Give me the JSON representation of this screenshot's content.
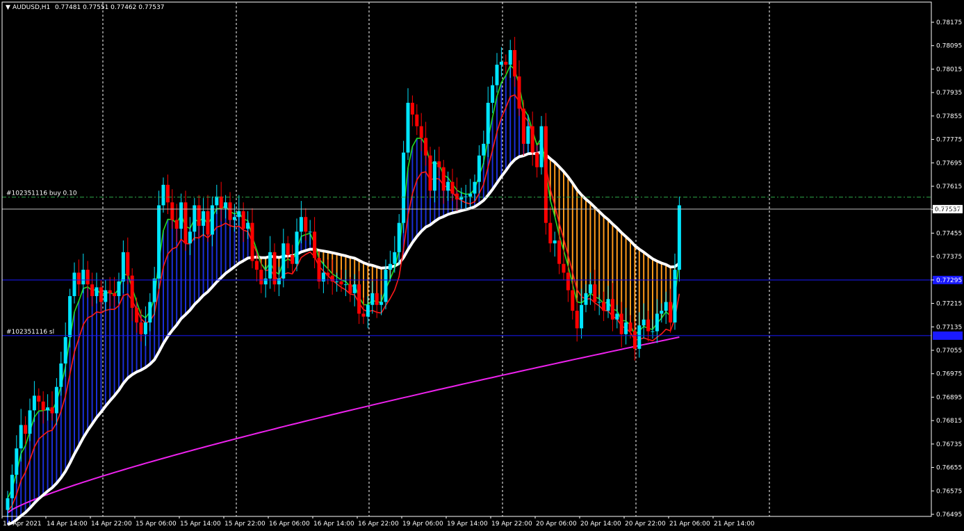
{
  "header": {
    "symbol": "AUDUSD,H1",
    "ohlc": "0.77481 0.77551 0.77462 0.77537"
  },
  "orders": {
    "buy_label": "#102351116 buy 0.10",
    "buy_price": 0.77578,
    "sl_label": "#102351116 sl",
    "sl_price": 0.771
  },
  "current_price": 0.77537,
  "current_price_label": "0.77537",
  "levels": {
    "upper_blue": 0.77295,
    "lower_blue": 0.77105
  },
  "colors": {
    "bull": "#00e5ff",
    "bear": "#ff0000",
    "hist_bull": "#1a2fd8",
    "hist_bear": "#ff9a1a",
    "green_line": "#22dd22",
    "red_line": "#ff1a1a",
    "white_line": "#ffffff",
    "magenta_line": "#ee22ee",
    "level_line": "#1a1aff"
  },
  "chart_data": {
    "type": "candlestick",
    "yaxis_ticks": [
      "0.78175",
      "0.78095",
      "0.78015",
      "0.77935",
      "0.77855",
      "0.77775",
      "0.77695",
      "0.77615",
      "0.77535",
      "0.77455",
      "0.77375",
      "0.77295",
      "0.77215",
      "0.77135",
      "0.77055",
      "0.76975",
      "0.76895",
      "0.76815",
      "0.76735",
      "0.76655",
      "0.76575",
      "0.76495"
    ],
    "ylim": [
      0.76495,
      0.78175
    ],
    "x_labels": [
      "14 Apr 2021",
      "14 Apr 14:00",
      "14 Apr 22:00",
      "15 Apr 06:00",
      "15 Apr 14:00",
      "15 Apr 22:00",
      "16 Apr 06:00",
      "16 Apr 14:00",
      "16 Apr 22:00",
      "19 Apr 06:00",
      "19 Apr 14:00",
      "19 Apr 22:00",
      "20 Apr 06:00",
      "20 Apr 14:00",
      "20 Apr 22:00",
      "21 Apr 06:00",
      "21 Apr 14:00"
    ],
    "close": [
      0.7655,
      0.7663,
      0.7672,
      0.768,
      0.7677,
      0.7685,
      0.769,
      0.7688,
      0.7685,
      0.7686,
      0.7684,
      0.7693,
      0.7701,
      0.771,
      0.7724,
      0.7732,
      0.7728,
      0.7733,
      0.7728,
      0.7724,
      0.7727,
      0.7722,
      0.7726,
      0.7725,
      0.7724,
      0.7729,
      0.7739,
      0.7731,
      0.772,
      0.7715,
      0.7711,
      0.7715,
      0.7722,
      0.773,
      0.7755,
      0.7762,
      0.7756,
      0.775,
      0.7747,
      0.7756,
      0.7742,
      0.7746,
      0.7755,
      0.7748,
      0.7753,
      0.7745,
      0.7755,
      0.7758,
      0.7754,
      0.7756,
      0.775,
      0.7751,
      0.7753,
      0.7747,
      0.7749,
      0.7736,
      0.7733,
      0.7728,
      0.773,
      0.7739,
      0.7728,
      0.773,
      0.7742,
      0.7738,
      0.7735,
      0.7746,
      0.7751,
      0.7746,
      0.7746,
      0.7737,
      0.7729,
      0.7732,
      0.7731,
      0.7729,
      0.7729,
      0.7728,
      0.7728,
      0.7725,
      0.7728,
      0.7718,
      0.7717,
      0.7721,
      0.7725,
      0.7721,
      0.7722,
      0.7733,
      0.7735,
      0.7739,
      0.7749,
      0.7773,
      0.779,
      0.7786,
      0.7782,
      0.7778,
      0.7772,
      0.776,
      0.777,
      0.7768,
      0.776,
      0.7763,
      0.7759,
      0.7757,
      0.7758,
      0.7758,
      0.7759,
      0.7763,
      0.7772,
      0.7776,
      0.779,
      0.7796,
      0.7803,
      0.7804,
      0.7803,
      0.7808,
      0.7799,
      0.7788,
      0.7776,
      0.7782,
      0.7773,
      0.7768,
      0.7782,
      0.7749,
      0.7742,
      0.7743,
      0.7735,
      0.7732,
      0.7726,
      0.7719,
      0.7713,
      0.7721,
      0.7725,
      0.7728,
      0.7722,
      0.7722,
      0.7719,
      0.7723,
      0.7716,
      0.7718,
      0.7711,
      0.7715,
      0.7712,
      0.7706,
      0.7714,
      0.7716,
      0.7712,
      0.7712,
      0.7718,
      0.7719,
      0.7722,
      0.7715,
      0.7733,
      0.7755
    ],
    "series": [
      {
        "name": "",
        "values": []
      }
    ]
  }
}
